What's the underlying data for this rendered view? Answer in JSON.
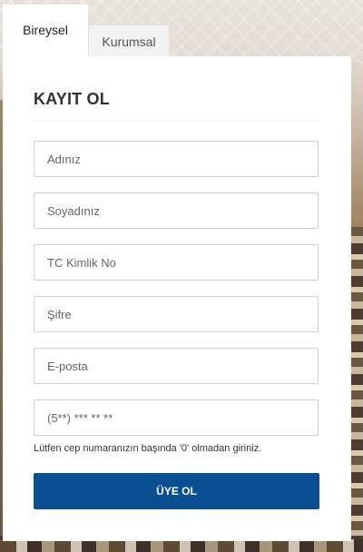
{
  "tabs": {
    "individual": "Bireysel",
    "corporate": "Kurumsal"
  },
  "form": {
    "title": "KAYIT OL",
    "fields": {
      "first_name": "Adınız",
      "last_name": "Soyadınız",
      "tc_id": "TC Kimlik No",
      "password": "Şifre",
      "email": "E-posta",
      "phone": "(5**) *** ** **"
    },
    "phone_hint": "Lütfen cep numaranızın başında '0' olmadan giriniz.",
    "submit_label": "ÜYE OL"
  },
  "colors": {
    "primary_button": "#0a4f92"
  }
}
